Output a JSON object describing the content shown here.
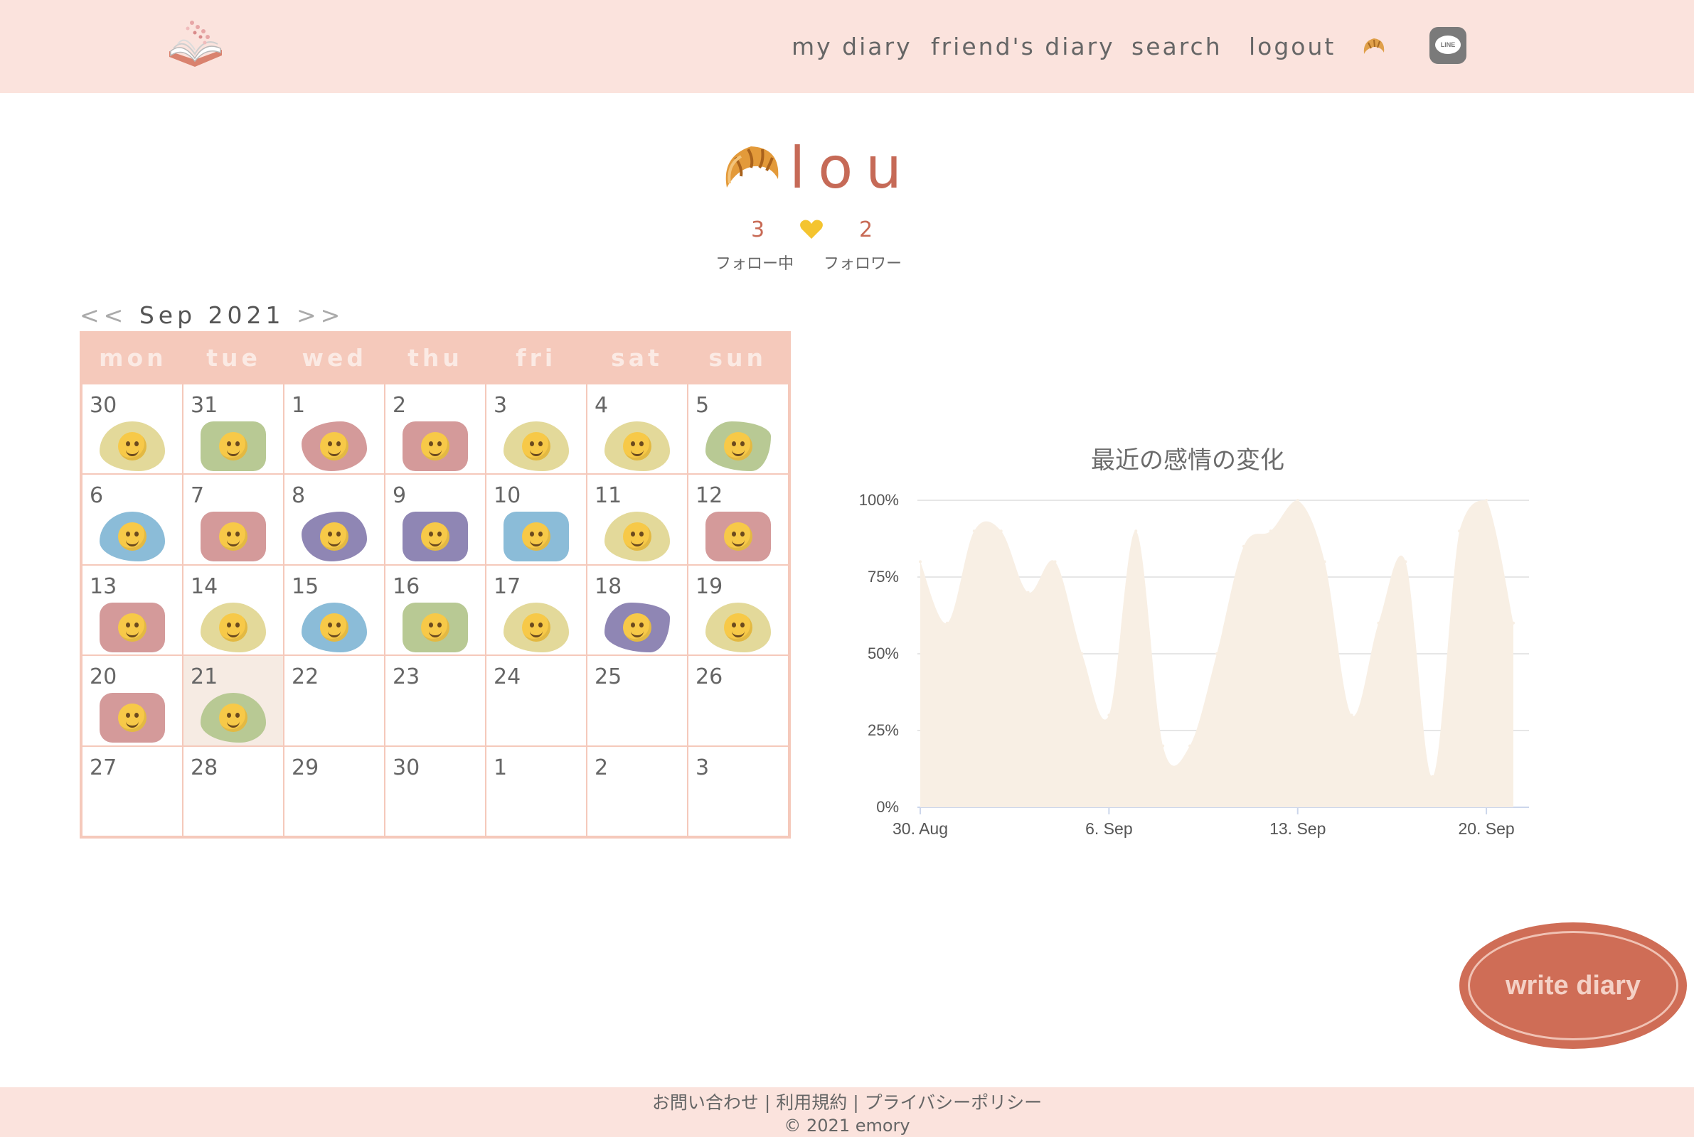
{
  "header": {
    "nav": [
      {
        "label": "my diary"
      },
      {
        "label": "friend's diary"
      },
      {
        "label": "search"
      },
      {
        "label": "logout"
      }
    ],
    "icons": {
      "logo": "open-book-logo-icon",
      "profile": "croissant-icon",
      "line": "line-icon"
    }
  },
  "profile": {
    "icon": "croissant-icon",
    "name": "lou",
    "following_count": "3",
    "following_label": "フォロー中",
    "followers_count": "2",
    "followers_label": "フォロワー",
    "heart_icon": "yellow-heart-icon"
  },
  "calendar": {
    "prev": "<<",
    "month_label": "Sep 2021",
    "next": ">>",
    "weekdays": [
      "mon",
      "tue",
      "wed",
      "thu",
      "fri",
      "sat",
      "sun"
    ],
    "days": [
      {
        "day": "30",
        "mood": "kissing-face-icon",
        "color": "#e3d99a",
        "shape": 0
      },
      {
        "day": "31",
        "mood": "grinning-face-icon",
        "color": "#b8c994",
        "shape": 1
      },
      {
        "day": "1",
        "mood": "tears-of-joy-face-icon",
        "color": "#d49a9a",
        "shape": 2
      },
      {
        "day": "2",
        "mood": "flushed-face-icon",
        "color": "#d49a9a",
        "shape": 1
      },
      {
        "day": "3",
        "mood": "smiling-eyes-face-icon",
        "color": "#e3d99a",
        "shape": 0
      },
      {
        "day": "4",
        "mood": "blush-face-icon",
        "color": "#e3d99a",
        "shape": 0
      },
      {
        "day": "5",
        "mood": "thinking-face-icon",
        "color": "#b8c994",
        "shape": 3
      },
      {
        "day": "6",
        "mood": "sleeping-face-icon",
        "color": "#8bbcd8",
        "shape": 0
      },
      {
        "day": "7",
        "mood": "yum-face-icon",
        "color": "#d49a9a",
        "shape": 1
      },
      {
        "day": "8",
        "mood": "woozy-face-icon",
        "color": "#8f86b4",
        "shape": 2
      },
      {
        "day": "9",
        "mood": "sneezing-face-icon",
        "color": "#8f86b4",
        "shape": 1
      },
      {
        "day": "10",
        "mood": "hushed-face-icon",
        "color": "#8bbcd8",
        "shape": 1
      },
      {
        "day": "11",
        "mood": "blush-face-icon",
        "color": "#e3d99a",
        "shape": 0
      },
      {
        "day": "12",
        "mood": "hugging-face-icon",
        "color": "#d49a9a",
        "shape": 1
      },
      {
        "day": "13",
        "mood": "party-face-icon",
        "color": "#d49a9a",
        "shape": 1
      },
      {
        "day": "14",
        "mood": "sunglasses-face-icon",
        "color": "#e3d99a",
        "shape": 0
      },
      {
        "day": "15",
        "mood": "angry-face-icon",
        "color": "#8bbcd8",
        "shape": 0
      },
      {
        "day": "16",
        "mood": "slight-smile-face-icon",
        "color": "#b8c994",
        "shape": 1
      },
      {
        "day": "17",
        "mood": "laughing-face-icon",
        "color": "#e3d99a",
        "shape": 0
      },
      {
        "day": "18",
        "mood": "tired-face-icon",
        "color": "#8f86b4",
        "shape": 3
      },
      {
        "day": "19",
        "mood": "relieved-face-icon",
        "color": "#e3d99a",
        "shape": 0
      },
      {
        "day": "20",
        "mood": "smiling-hearts-face-icon",
        "color": "#d49a9a",
        "shape": 1
      },
      {
        "day": "21",
        "mood": "grinning-face-icon",
        "color": "#b8c994",
        "shape": 0,
        "today": true
      },
      {
        "day": "22"
      },
      {
        "day": "23"
      },
      {
        "day": "24"
      },
      {
        "day": "25"
      },
      {
        "day": "26"
      },
      {
        "day": "27"
      },
      {
        "day": "28"
      },
      {
        "day": "29"
      },
      {
        "day": "30"
      },
      {
        "day": "1"
      },
      {
        "day": "2"
      },
      {
        "day": "3"
      }
    ]
  },
  "chart_data": {
    "type": "area",
    "title": "最近の感情の変化",
    "xlabel": "",
    "ylabel": "",
    "x": [
      "2021-08-30",
      "2021-08-31",
      "2021-09-01",
      "2021-09-02",
      "2021-09-03",
      "2021-09-04",
      "2021-09-05",
      "2021-09-06",
      "2021-09-07",
      "2021-09-08",
      "2021-09-09",
      "2021-09-10",
      "2021-09-11",
      "2021-09-12",
      "2021-09-13",
      "2021-09-14",
      "2021-09-15",
      "2021-09-16",
      "2021-09-17",
      "2021-09-18",
      "2021-09-19",
      "2021-09-20",
      "2021-09-21"
    ],
    "x_tick_labels": [
      "30. Aug",
      "6. Sep",
      "13. Sep",
      "20. Sep"
    ],
    "y_tick_labels": [
      "0%",
      "25%",
      "50%",
      "75%",
      "100%"
    ],
    "series": [
      {
        "values": [
          80,
          60,
          90,
          90,
          70,
          80,
          50,
          30,
          90,
          20,
          20,
          50,
          85,
          90,
          100,
          80,
          30,
          60,
          80,
          10,
          90,
          100,
          60
        ]
      }
    ],
    "ylim": [
      0,
      100
    ],
    "y_unit": "%",
    "grid": true,
    "fill_color": "#f8efe4",
    "grid_color": "#e6e6e6",
    "axis_color": "#ccd6eb"
  },
  "write_button": {
    "label": "write diary"
  },
  "footer": {
    "links": [
      "お問い合わせ",
      "利用規約",
      "プライバシーポリシー"
    ],
    "separator": " | ",
    "copyright": "© 2021 emory"
  }
}
